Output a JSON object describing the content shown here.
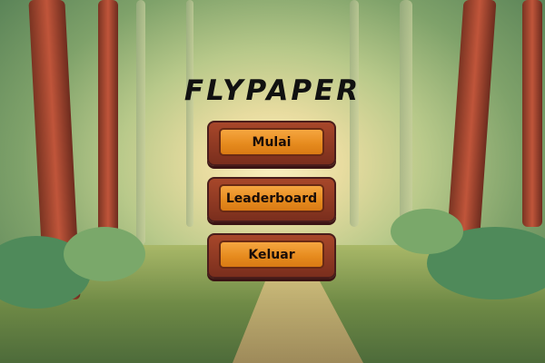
{
  "game": {
    "title": "FLYPAPER"
  },
  "menu": [
    {
      "label": "Mulai"
    },
    {
      "label": "Leaderboard"
    },
    {
      "label": "Keluar"
    }
  ],
  "colors": {
    "button_face": "#e58a1d",
    "button_frame": "#8b3a22",
    "title": "#111111"
  }
}
